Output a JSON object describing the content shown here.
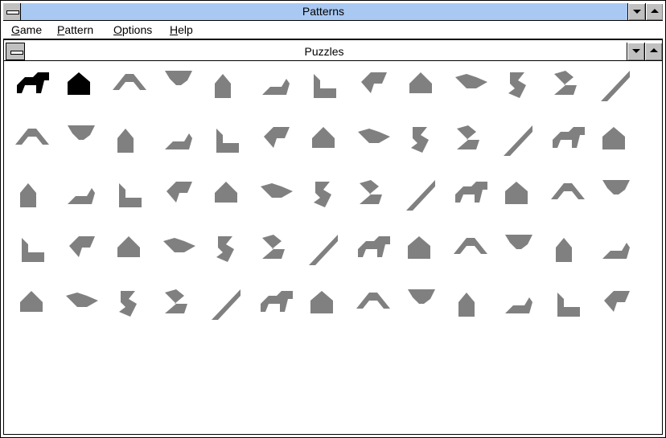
{
  "window": {
    "title": "Patterns"
  },
  "menu": [
    {
      "first": "G",
      "rest": "ame"
    },
    {
      "first": "P",
      "rest": "attern"
    },
    {
      "first": "O",
      "rest": "ptions"
    },
    {
      "first": "H",
      "rest": "elp"
    }
  ],
  "child": {
    "title": "Puzzles"
  },
  "puzzles": {
    "rows": 5,
    "per_row": [
      13,
      13,
      13,
      13,
      13
    ],
    "solved_count": 2,
    "solved_color": "#000000",
    "unsolved_color": "#808080"
  },
  "icons": {
    "system_menu": "system-menu-icon",
    "minimize": "minimize-arrow-icon",
    "maximize": "maximize-arrow-icon"
  }
}
